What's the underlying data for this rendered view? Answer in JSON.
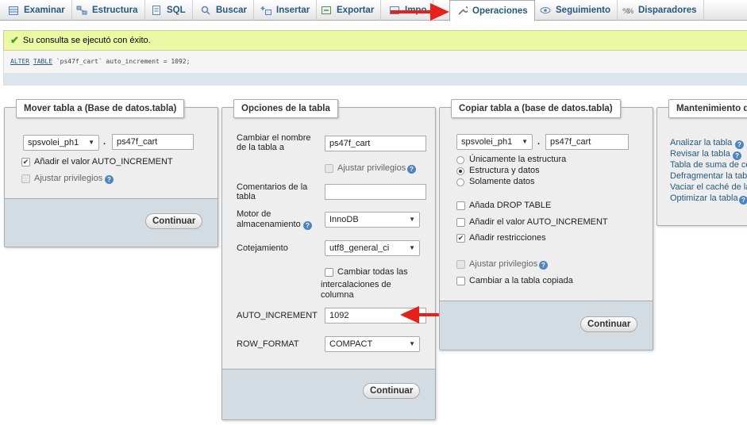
{
  "tabs": [
    {
      "label": "Examinar",
      "icon": "table-browse-icon"
    },
    {
      "label": "Estructura",
      "icon": "structure-icon"
    },
    {
      "label": "SQL",
      "icon": "sql-icon"
    },
    {
      "label": "Buscar",
      "icon": "search-icon"
    },
    {
      "label": "Insertar",
      "icon": "insert-icon"
    },
    {
      "label": "Exportar",
      "icon": "export-icon"
    },
    {
      "label": "Impo",
      "icon": "import-icon"
    },
    {
      "label": "Operaciones",
      "icon": "wrench-icon",
      "active": true
    },
    {
      "label": "Seguimiento",
      "icon": "eye-icon"
    },
    {
      "label": "Disparadores",
      "icon": "triggers-icon"
    }
  ],
  "message": {
    "success_text": "Su consulta se ejecutó con éxito.",
    "sql_kw1": "ALTER",
    "sql_kw2": "TABLE",
    "sql_rest": " `ps47f_cart` auto_increment = 1092;"
  },
  "move_table": {
    "legend": "Mover tabla a (Base de datos.tabla)",
    "database": "spsvolei_ph1",
    "dot": ".",
    "table": "ps47f_cart",
    "auto_increment_label": "Añadir el valor AUTO_INCREMENT",
    "auto_increment_checked": true,
    "privileges_label": "Ajustar privilegios",
    "submit": "Continuar"
  },
  "table_options": {
    "legend": "Opciones de la tabla",
    "rename_label_1": "Cambiar el nombre",
    "rename_label_2": "de la tabla a",
    "rename_value": "ps47f_cart",
    "privileges_label": "Ajustar privilegios",
    "comments_label_1": "Comentarios de la",
    "comments_label_2": "tabla",
    "comments_value": "",
    "engine_label_1": "Motor de",
    "engine_label_2": "almacenamiento",
    "engine_value": "InnoDB",
    "collation_label": "Cotejamiento",
    "collation_value": "utf8_general_ci",
    "change_all_1": "Cambiar todas las",
    "change_all_2": "intercalaciones de",
    "change_all_3": "columna",
    "auto_increment_label": "AUTO_INCREMENT",
    "auto_increment_value": "1092",
    "row_format_label": "ROW_FORMAT",
    "row_format_value": "COMPACT",
    "submit": "Continuar"
  },
  "copy_table": {
    "legend": "Copiar tabla a (base de datos.tabla)",
    "database": "spsvolei_ph1",
    "dot": ".",
    "table": "ps47f_cart",
    "radio_structure_only": "Únicamente la estructura",
    "radio_structure_data": "Estructura y datos",
    "radio_data_only": "Solamente datos",
    "selected_radio": "Estructura y datos",
    "drop_table": "Añada DROP TABLE",
    "auto_increment": "Añadir el valor AUTO_INCREMENT",
    "constraints": "Añadir restricciones",
    "constraints_checked": true,
    "privileges": "Ajustar privilegios",
    "switch_to_copy": "Cambiar a la tabla copiada",
    "submit": "Continuar"
  },
  "maintenance": {
    "legend": "Mantenimiento de",
    "links": [
      "Analizar la tabla",
      "Revisar la tabla",
      "Tabla de suma de co",
      "Defragmentar la tabl",
      "Vaciar el caché de la",
      "Optimizar la tabla"
    ]
  },
  "annotation_color": "#e8201a"
}
